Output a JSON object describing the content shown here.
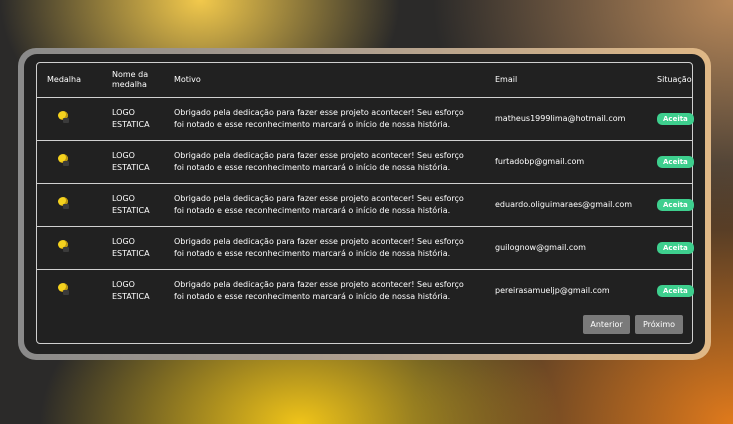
{
  "table": {
    "headers": {
      "medalha": "Medalha",
      "nome": "Nome da medalha",
      "motivo": "Motivo",
      "email": "Email",
      "situacao": "Situação"
    },
    "rows": [
      {
        "icon": "medal-icon",
        "nome": "LOGO ESTATICA",
        "motivo_line1": "Obrigado pela dedicação para fazer esse projeto acontecer! Seu esforço",
        "motivo_line2": "foi notado e esse reconhecimento marcará o início de nossa história.",
        "email": "matheus1999lima@hotmail.com",
        "status": "Aceita"
      },
      {
        "icon": "medal-icon",
        "nome": "LOGO ESTATICA",
        "motivo_line1": "Obrigado pela dedicação para fazer esse projeto acontecer! Seu esforço",
        "motivo_line2": "foi notado e esse reconhecimento marcará o início de nossa história.",
        "email": "furtadobp@gmail.com",
        "status": "Aceita"
      },
      {
        "icon": "medal-icon",
        "nome": "LOGO ESTATICA",
        "motivo_line1": "Obrigado pela dedicação para fazer esse projeto acontecer! Seu esforço",
        "motivo_line2": "foi notado e esse reconhecimento marcará o início de nossa história.",
        "email": "eduardo.oliguimaraes@gmail.com",
        "status": "Aceita"
      },
      {
        "icon": "medal-icon",
        "nome": "LOGO ESTATICA",
        "motivo_line1": "Obrigado pela dedicação para fazer esse projeto acontecer! Seu esforço",
        "motivo_line2": "foi notado e esse reconhecimento marcará o início de nossa história.",
        "email": "guilognow@gmail.com",
        "status": "Aceita"
      },
      {
        "icon": "medal-icon",
        "nome": "LOGO ESTATICA",
        "motivo_line1": "Obrigado pela dedicação para fazer esse projeto acontecer! Seu esforço",
        "motivo_line2": "foi notado e esse reconhecimento marcará o início de nossa história.",
        "email": "pereirasamueljp@gmail.com",
        "status": "Aceita"
      }
    ]
  },
  "pagination": {
    "prev_label": "Anterior",
    "next_label": "Próximo"
  },
  "colors": {
    "panel_bg": "#212121",
    "status_accepted": "#3ecf8e",
    "button_bg": "#7a7a7a",
    "medal": "#f5d21e"
  }
}
